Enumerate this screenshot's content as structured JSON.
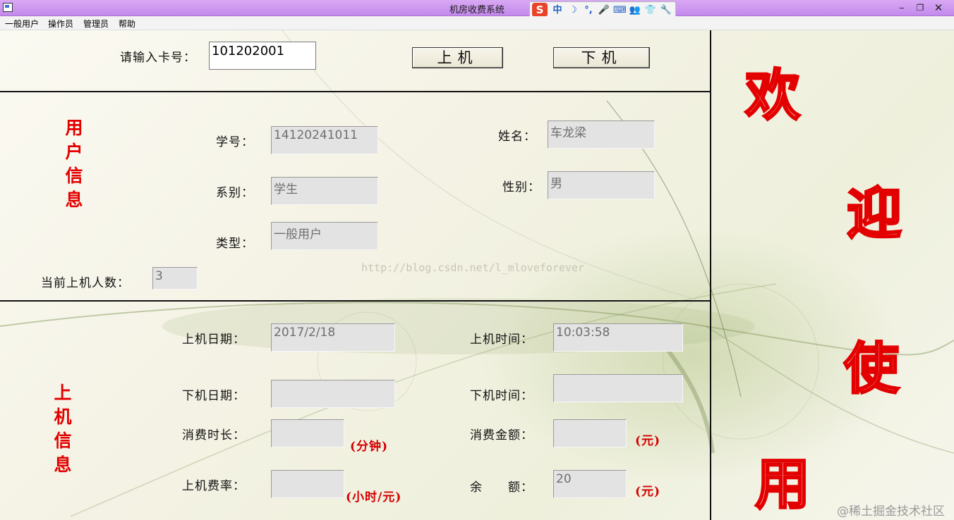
{
  "window": {
    "title": "机房收费系统",
    "controls": {
      "minimize": "‒",
      "maximize": "❐",
      "close": "✕"
    }
  },
  "ime": {
    "logo": "S",
    "items": [
      "中",
      "☽",
      "°,",
      "🎤",
      "⌨",
      "👥",
      "👕",
      "🔧"
    ]
  },
  "menu": [
    "一般用户",
    "操作员",
    "管理员",
    "帮助"
  ],
  "card": {
    "label": "请输入卡号：",
    "value": "101202001",
    "login_button": "上机",
    "logout_button": "下机"
  },
  "user_info": {
    "section_title": [
      "用",
      "户",
      "信",
      "息"
    ],
    "student_id_label": "学号：",
    "student_id": "14120241011",
    "name_label": "姓名：",
    "name": "车龙梁",
    "department_label": "系别：",
    "department": "学生",
    "gender_label": "性别：",
    "gender": "男",
    "type_label": "类型：",
    "type": "一般用户",
    "online_count_label": "当前上机人数：",
    "online_count": "3"
  },
  "watermark": "http://blog.csdn.net/l_mloveforever",
  "session_info": {
    "section_title": [
      "上",
      "机",
      "信",
      "息"
    ],
    "login_date_label": "上机日期：",
    "login_date": "2017/2/18",
    "login_time_label": "上机时间：",
    "login_time": "10:03:58",
    "logout_date_label": "下机日期：",
    "logout_date": "",
    "logout_time_label": "下机时间：",
    "logout_time": "",
    "duration_label": "消费时长：",
    "duration": "",
    "duration_unit": "(分钟)",
    "cost_label": "消费金额：",
    "cost": "",
    "cost_unit": "(元)",
    "rate_label": "上机费率：",
    "rate": "",
    "rate_unit": "(小时/元)",
    "balance_label": "余　　额：",
    "balance": "20",
    "balance_unit": "(元)"
  },
  "welcome": [
    "欢",
    "迎",
    "使",
    "用"
  ],
  "corner_watermark": "@稀土掘金技术社区",
  "colors": {
    "title_bar": "#c389ec",
    "accent_red": "#e30000",
    "field_bg": "#e3e3e3"
  }
}
